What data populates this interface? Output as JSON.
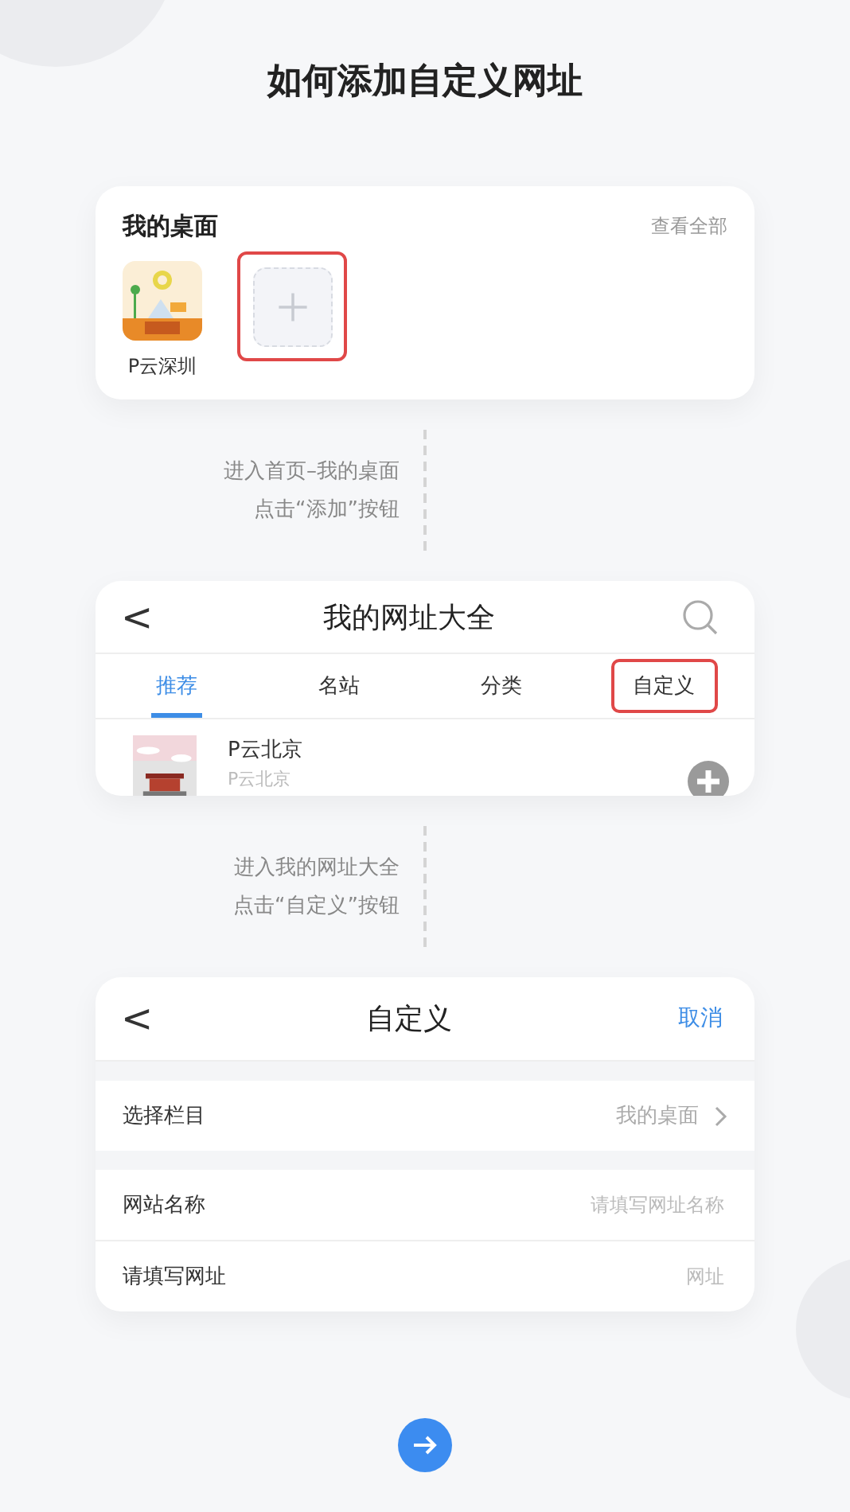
{
  "title": "如何添加自定义网址",
  "desktop_card": {
    "title": "我的桌面",
    "link": "查看全部",
    "apps": [
      {
        "kind": "picture",
        "label": "P云深圳"
      },
      {
        "kind": "add",
        "highlighted": true
      }
    ]
  },
  "steps": [
    {
      "lines": [
        "进入首页–我的桌面",
        "点击“添加”按钮"
      ]
    },
    {
      "lines": [
        "进入我的网址大全",
        "点击“自定义”按钮"
      ]
    }
  ],
  "sites_card": {
    "back": "<",
    "title": "我的网址大全",
    "tabs": [
      {
        "label": "推荐",
        "selected": true,
        "highlighted": false
      },
      {
        "label": "名站",
        "selected": false,
        "highlighted": false
      },
      {
        "label": "分类",
        "selected": false,
        "highlighted": false
      },
      {
        "label": "自定义",
        "selected": false,
        "highlighted": true
      }
    ],
    "items": [
      {
        "kind": "picture",
        "name": "P云北京",
        "subtitle": "P云北京"
      }
    ]
  },
  "custom_card": {
    "back": "<",
    "title": "自定义",
    "action": "取消",
    "rows": [
      {
        "kind": "select",
        "label": "选择栏目",
        "value": "我的桌面"
      },
      {
        "kind": "input",
        "label": "网站名称",
        "placeholder": "请填写网址名称"
      },
      {
        "kind": "input",
        "label": "请填写网址",
        "placeholder": "网址"
      }
    ]
  }
}
